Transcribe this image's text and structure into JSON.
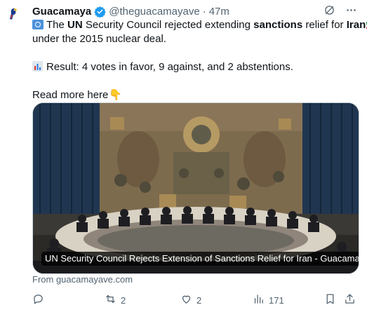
{
  "post": {
    "author_name": "Guacamaya",
    "handle": "@theguacamayave",
    "separator": "·",
    "time": "47m",
    "line1_pre": "The ",
    "line1_b1": "UN",
    "line1_mid": " Security Council rejected extending ",
    "line1_b2": "sanctions",
    "line1_mid2": " relief for ",
    "line1_b3": "Iran",
    "line2": "under the 2015 nuclear deal.",
    "line3": "Result: 4 votes in favor, 9 against, and 2 abstentions.",
    "line4": "Read more here",
    "hand_emoji": "👇"
  },
  "card": {
    "caption": "UN Security Council Rejects Extension of Sanctions Relief for Iran - Guacamaya",
    "source": "From guacamayave.com"
  },
  "actions": {
    "reposts": "2",
    "likes": "2",
    "views": "171"
  },
  "colors": {
    "verified": "#1d9bf0",
    "secondary_text": "#536471",
    "un_blue": "#4b92db"
  },
  "icons": [
    "parrot-avatar",
    "verified-badge-icon",
    "grok-icon",
    "more-icon",
    "reply-icon",
    "repost-icon",
    "like-icon",
    "views-icon",
    "bookmark-icon",
    "share-icon"
  ]
}
